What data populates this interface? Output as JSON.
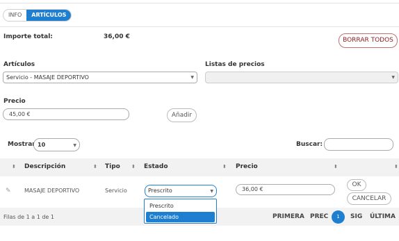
{
  "tabs": [
    {
      "label": "INFO"
    },
    {
      "label": "ARTÍCULOS"
    }
  ],
  "summary": {
    "total_label": "Importe total:",
    "total_value": "36,00 €",
    "clear_button": "BORRAR TODOS"
  },
  "articulos": {
    "label": "Artículos",
    "selected": "Servicio - MASAJE DEPORTIVO"
  },
  "listas": {
    "label": "Listas de precios",
    "selected": ""
  },
  "precio": {
    "label": "Precio",
    "value": "45,00 €",
    "add_button": "Añadir"
  },
  "table_controls": {
    "show_label": "Mostrar",
    "show_value": "10",
    "search_label": "Buscar:",
    "search_value": ""
  },
  "columns": [
    "Descripción",
    "Tipo",
    "Estado",
    "Precio"
  ],
  "row": {
    "description": "MASAJE DEPORTIVO",
    "type": "Servicio",
    "status": "Prescrito",
    "price": "36,00 €",
    "ok_button": "OK",
    "cancel_button": "CANCELAR"
  },
  "status_options": [
    "Prescrito",
    "Cancelado"
  ],
  "status_highlighted": "Cancelado",
  "footer": {
    "info": "Filas de 1 a 1 de 1",
    "first": "PRIMERA",
    "prev": "PREC",
    "page": "1",
    "next": "SIG",
    "last": "ÚLTIMA"
  },
  "colors": {
    "accent": "#1e7fd1",
    "danger": "#8b1c1c"
  },
  "icons": {
    "row_icon": "pencil-icon",
    "sort_icon": "sort-both-icon",
    "caret_icon": "chevron-down-icon"
  }
}
